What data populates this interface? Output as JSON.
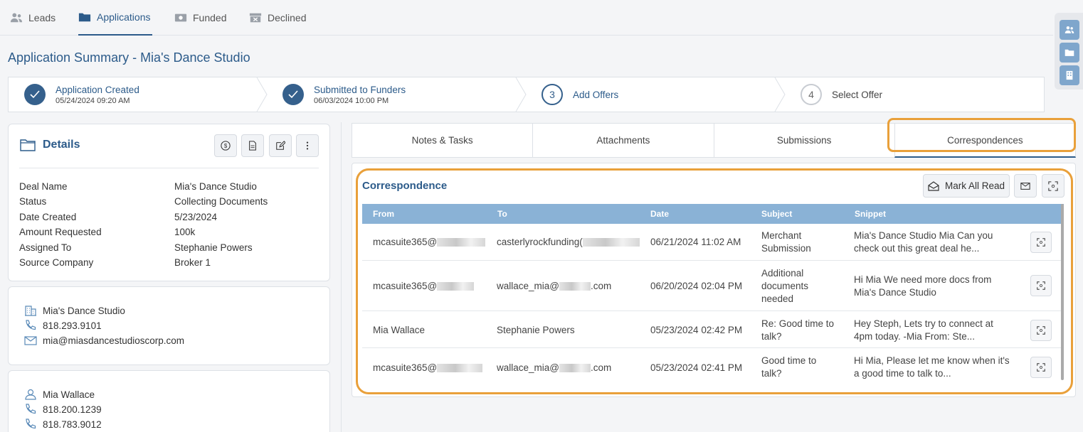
{
  "nav": {
    "tabs": [
      {
        "label": "Leads",
        "icon": "users-icon"
      },
      {
        "label": "Applications",
        "icon": "folder-icon",
        "active": true
      },
      {
        "label": "Funded",
        "icon": "money-icon"
      },
      {
        "label": "Declined",
        "icon": "archive-icon"
      }
    ]
  },
  "page": {
    "title": "Application Summary - Mia's Dance Studio"
  },
  "stepper": {
    "steps": [
      {
        "label": "Application Created",
        "date": "05/24/2024 09:20 AM",
        "state": "done"
      },
      {
        "label": "Submitted to Funders",
        "date": "06/03/2024 10:00 PM",
        "state": "done"
      },
      {
        "number": "3",
        "label": "Add Offers",
        "state": "current"
      },
      {
        "number": "4",
        "label": "Select Offer",
        "state": "todo"
      }
    ]
  },
  "details": {
    "title": "Details",
    "fields": [
      {
        "key": "Deal Name",
        "value": "Mia's Dance Studio"
      },
      {
        "key": "Status",
        "value": "Collecting Documents"
      },
      {
        "key": "Date Created",
        "value": "5/23/2024"
      },
      {
        "key": "Amount Requested",
        "value": "100k"
      },
      {
        "key": "Assigned To",
        "value": "Stephanie Powers"
      },
      {
        "key": "Source Company",
        "value": "Broker 1"
      }
    ]
  },
  "company_contact": {
    "name": "Mia's Dance Studio",
    "phone": "818.293.9101",
    "email": "mia@miasdancestudioscorp.com"
  },
  "person_contact": {
    "name": "Mia Wallace",
    "phone1": "818.200.1239",
    "phone2": "818.783.9012"
  },
  "tabs": {
    "items": [
      "Notes & Tasks",
      "Attachments",
      "Submissions",
      "Correspondences"
    ],
    "active": "Correspondences"
  },
  "correspondence": {
    "title": "Correspondence",
    "mark_all_read": "Mark All Read",
    "columns": [
      "From",
      "To",
      "Date",
      "Subject",
      "Snippet"
    ],
    "rows": [
      {
        "from": "mcasuite365@",
        "to": "casterlyrockfunding(",
        "date": "06/21/2024 11:02 AM",
        "subject": [
          "Merchant",
          "Submission"
        ],
        "snippet": [
          "Mia's Dance Studio Mia Can you",
          "check out this great deal he..."
        ]
      },
      {
        "from": "mcasuite365@",
        "to": "wallace_mia@",
        "to_suffix": ".com",
        "date": "06/20/2024 02:04 PM",
        "subject": [
          "Additional",
          "documents",
          "needed"
        ],
        "snippet": [
          "Hi Mia We need more docs from",
          "Mia's Dance Studio"
        ]
      },
      {
        "from": "Mia Wallace",
        "to": "Stephanie Powers",
        "date": "05/23/2024 02:42 PM",
        "subject": [
          "Re: Good time to",
          "talk?"
        ],
        "snippet": [
          "Hey Steph, Lets try to connect at",
          "4pm today. -Mia From: Ste..."
        ]
      },
      {
        "from": "mcasuite365@",
        "to": "wallace_mia@",
        "to_suffix": ".com",
        "date": "05/23/2024 02:41 PM",
        "subject": [
          "Good time to",
          "talk?"
        ],
        "snippet": [
          "Hi Mia, Please let me know when it's",
          "a good time to talk to..."
        ]
      }
    ]
  },
  "colors": {
    "primary": "#2c5b8a",
    "highlight": "#e9a03a",
    "table_header": "#8ab2d6"
  }
}
